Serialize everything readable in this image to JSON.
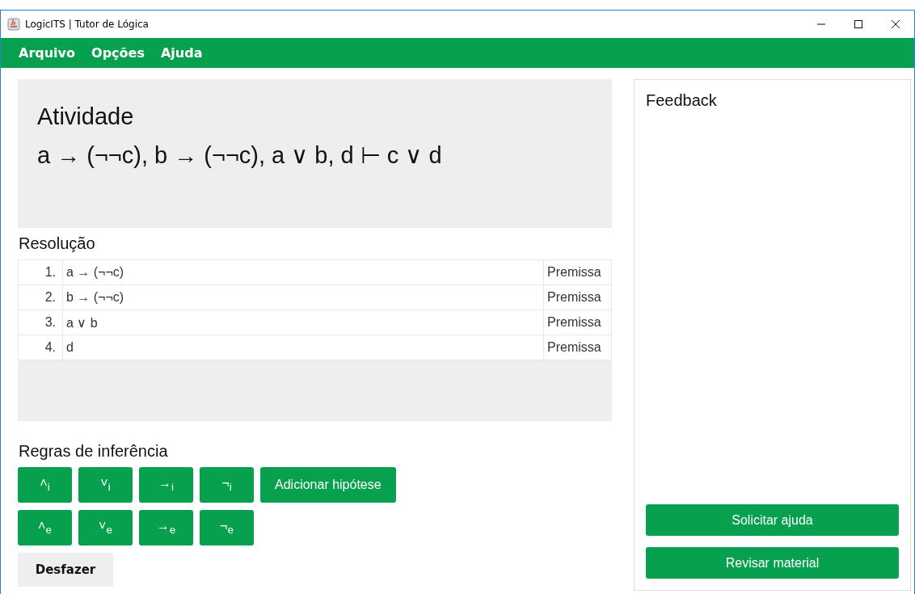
{
  "window": {
    "title": "LogicITS | Tutor de Lógica"
  },
  "menu": [
    "Arquivo",
    "Opções",
    "Ajuda"
  ],
  "activity": {
    "heading": "Atividade",
    "formula": "a → (¬¬c), b → (¬¬c), a ∨ b, d ⊢ c ∨ d"
  },
  "resolution": {
    "heading": "Resolução",
    "rows": [
      {
        "number": "1.",
        "formula": "a → (¬¬c)",
        "rule": "Premissa"
      },
      {
        "number": "2.",
        "formula": "b → (¬¬c)",
        "rule": "Premissa"
      },
      {
        "number": "3.",
        "formula": "a ∨ b",
        "rule": "Premissa"
      },
      {
        "number": "4.",
        "formula": "d",
        "rule": "Premissa"
      }
    ]
  },
  "rules": {
    "heading": "Regras de inferência",
    "rows": [
      [
        "˄$_{i}$",
        "˅$_{i}$",
        "→$_{i}$",
        "¬$_{i}$",
        "Adicionar hipótese"
      ],
      [
        "˄$_{e}$",
        "˅$_{e}$",
        "→$_{e}$",
        "¬$_{e}$"
      ]
    ],
    "undo": "Desfazer"
  },
  "feedback": {
    "heading": "Feedback",
    "buttons": [
      "Solicitar ajuda",
      "Revisar material"
    ]
  }
}
